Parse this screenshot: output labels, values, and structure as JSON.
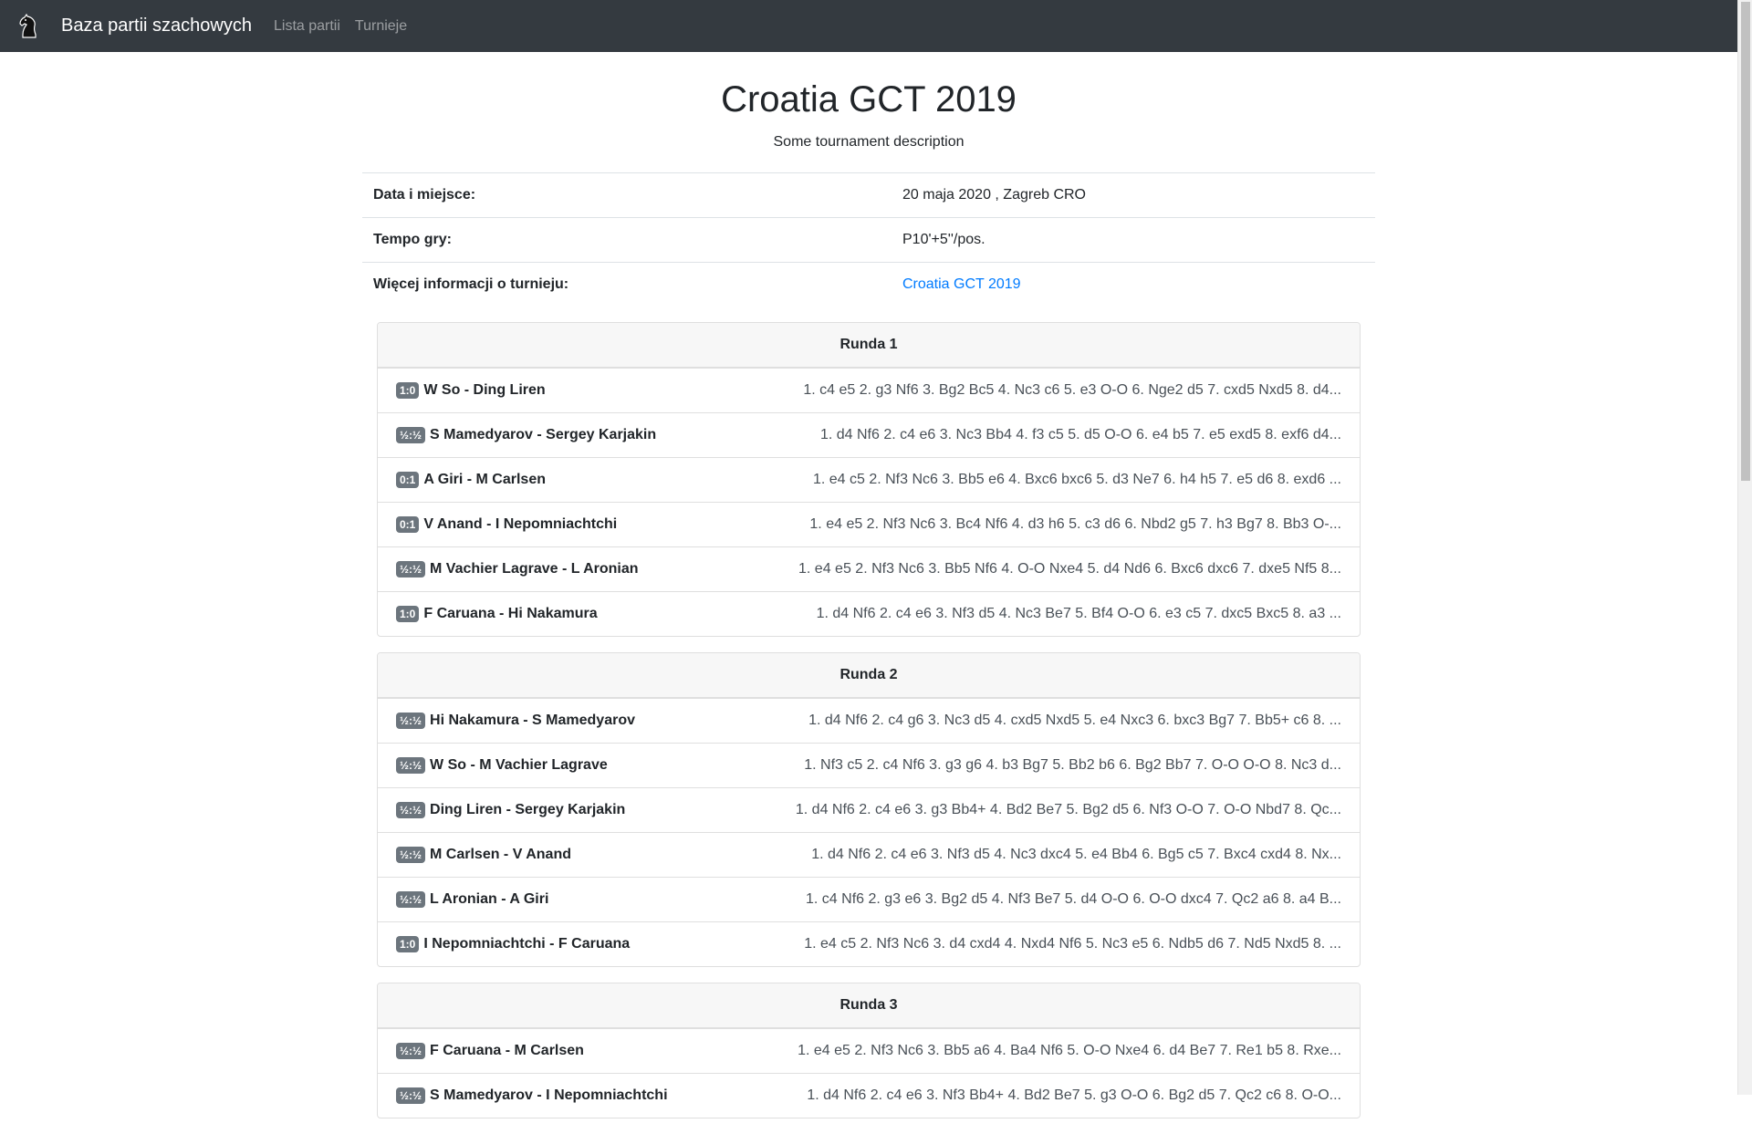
{
  "navbar": {
    "logo_icon": "chess-knight-icon",
    "brand": "Baza partii szachowych",
    "links": [
      "Lista partii",
      "Turnieje"
    ]
  },
  "tournament": {
    "title": "Croatia GCT 2019",
    "description": "Some tournament description",
    "info": {
      "date_label": "Data i miejsce:",
      "date_value": "20 maja 2020 , Zagreb CRO",
      "tempo_label": "Tempo gry:",
      "tempo_value": "P10'+5''/pos.",
      "more_label": "Więcej informacji o turnieju:",
      "more_link": "Croatia GCT 2019"
    }
  },
  "rounds": [
    {
      "title": "Runda 1",
      "games": [
        {
          "result": "1:0",
          "players": "W So - Ding Liren",
          "moves": "1. c4 e5 2. g3 Nf6 3. Bg2 Bc5 4. Nc3 c6 5. e3 O-O 6. Nge2 d5 7. cxd5 Nxd5 8. d4..."
        },
        {
          "result": "½:½",
          "players": "S Mamedyarov - Sergey Karjakin",
          "moves": "1. d4 Nf6 2. c4 e6 3. Nc3 Bb4 4. f3 c5 5. d5 O-O 6. e4 b5 7. e5 exd5 8. exf6 d4..."
        },
        {
          "result": "0:1",
          "players": "A Giri - M Carlsen",
          "moves": "1. e4 c5 2. Nf3 Nc6 3. Bb5 e6 4. Bxc6 bxc6 5. d3 Ne7 6. h4 h5 7. e5 d6 8. exd6 ..."
        },
        {
          "result": "0:1",
          "players": "V Anand - I Nepomniachtchi",
          "moves": "1. e4 e5 2. Nf3 Nc6 3. Bc4 Nf6 4. d3 h6 5. c3 d6 6. Nbd2 g5 7. h3 Bg7 8. Bb3 O-..."
        },
        {
          "result": "½:½",
          "players": "M Vachier Lagrave - L Aronian",
          "moves": "1. e4 e5 2. Nf3 Nc6 3. Bb5 Nf6 4. O-O Nxe4 5. d4 Nd6 6. Bxc6 dxc6 7. dxe5 Nf5 8..."
        },
        {
          "result": "1:0",
          "players": "F Caruana - Hi Nakamura",
          "moves": "1. d4 Nf6 2. c4 e6 3. Nf3 d5 4. Nc3 Be7 5. Bf4 O-O 6. e3 c5 7. dxc5 Bxc5 8. a3 ..."
        }
      ]
    },
    {
      "title": "Runda 2",
      "games": [
        {
          "result": "½:½",
          "players": "Hi Nakamura - S Mamedyarov",
          "moves": "1. d4 Nf6 2. c4 g6 3. Nc3 d5 4. cxd5 Nxd5 5. e4 Nxc3 6. bxc3 Bg7 7. Bb5+ c6 8. ..."
        },
        {
          "result": "½:½",
          "players": "W So - M Vachier Lagrave",
          "moves": "1. Nf3 c5 2. c4 Nf6 3. g3 g6 4. b3 Bg7 5. Bb2 b6 6. Bg2 Bb7 7. O-O O-O 8. Nc3 d..."
        },
        {
          "result": "½:½",
          "players": "Ding Liren - Sergey Karjakin",
          "moves": "1. d4 Nf6 2. c4 e6 3. g3 Bb4+ 4. Bd2 Be7 5. Bg2 d5 6. Nf3 O-O 7. O-O Nbd7 8. Qc..."
        },
        {
          "result": "½:½",
          "players": "M Carlsen - V Anand",
          "moves": "1. d4 Nf6 2. c4 e6 3. Nf3 d5 4. Nc3 dxc4 5. e4 Bb4 6. Bg5 c5 7. Bxc4 cxd4 8. Nx..."
        },
        {
          "result": "½:½",
          "players": "L Aronian - A Giri",
          "moves": "1. c4 Nf6 2. g3 e6 3. Bg2 d5 4. Nf3 Be7 5. d4 O-O 6. O-O dxc4 7. Qc2 a6 8. a4 B..."
        },
        {
          "result": "1:0",
          "players": "I Nepomniachtchi - F Caruana",
          "moves": "1. e4 c5 2. Nf3 Nc6 3. d4 cxd4 4. Nxd4 Nf6 5. Nc3 e5 6. Ndb5 d6 7. Nd5 Nxd5 8. ..."
        }
      ]
    },
    {
      "title": "Runda 3",
      "games": [
        {
          "result": "½:½",
          "players": "F Caruana - M Carlsen",
          "moves": "1. e4 e5 2. Nf3 Nc6 3. Bb5 a6 4. Ba4 Nf6 5. O-O Nxe4 6. d4 Be7 7. Re1 b5 8. Rxe..."
        },
        {
          "result": "½:½",
          "players": "S Mamedyarov - I Nepomniachtchi",
          "moves": "1. d4 Nf6 2. c4 e6 3. Nf3 Bb4+ 4. Bd2 Be7 5. g3 O-O 6. Bg2 d5 7. Qc2 c6 8. O-O..."
        }
      ]
    }
  ]
}
